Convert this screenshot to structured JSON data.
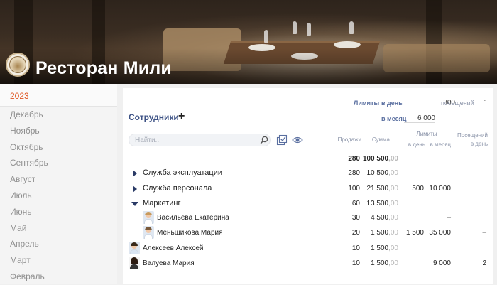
{
  "header": {
    "title": "Ресторан Мили"
  },
  "sidebar": {
    "items": [
      {
        "label": "2023"
      },
      {
        "label": "Декабрь"
      },
      {
        "label": "Ноябрь"
      },
      {
        "label": "Октябрь"
      },
      {
        "label": "Сентябрь"
      },
      {
        "label": "Август"
      },
      {
        "label": "Июль"
      },
      {
        "label": "Июнь"
      },
      {
        "label": "Май"
      },
      {
        "label": "Апрель"
      },
      {
        "label": "Март"
      },
      {
        "label": "Февраль"
      }
    ]
  },
  "limits": {
    "label": "Лимиты",
    "per_day_label": "в день",
    "per_month_label": "в месяц",
    "per_day_value": "300",
    "per_month_value": "6 000",
    "visits_label": "посещений",
    "visits_value": "1"
  },
  "employees": {
    "title": "Сотрудники",
    "search_placeholder": "Найти..."
  },
  "columns": {
    "sales": "Продажи",
    "sum": "Сумма",
    "limits": "Лимиты",
    "per_day": "в день",
    "per_month": "в месяц",
    "visits": "Посещений в день"
  },
  "totals": {
    "sales": "280",
    "sum_int": "100 500",
    "sum_dec": ",00"
  },
  "rows": [
    {
      "name": "Служба эксплуатации",
      "sales": "280",
      "sum_int": "10 500",
      "sum_dec": ",00",
      "day": "",
      "month": "",
      "visits": ""
    },
    {
      "name": "Служба персонала",
      "sales": "100",
      "sum_int": "21 500",
      "sum_dec": ",00",
      "day": "500",
      "month": "10 000",
      "visits": ""
    },
    {
      "name": "Маркетинг",
      "sales": "60",
      "sum_int": "13 500",
      "sum_dec": ",00",
      "day": "",
      "month": "",
      "visits": ""
    },
    {
      "name": "Васильева Екатерина",
      "sales": "30",
      "sum_int": "4 500",
      "sum_dec": ",00",
      "day": "",
      "month": "–",
      "visits": ""
    },
    {
      "name": "Меньшикова Мария",
      "sales": "20",
      "sum_int": "1 500",
      "sum_dec": ",00",
      "day": "1 500",
      "month": "35 000",
      "visits": "–"
    },
    {
      "name": "Алексеев Алексей",
      "sales": "10",
      "sum_int": "1 500",
      "sum_dec": ",00",
      "day": "",
      "month": "",
      "visits": ""
    },
    {
      "name": "Валуева Мария",
      "sales": "10",
      "sum_int": "1 500",
      "sum_dec": ",00",
      "day": "",
      "month": "9 000",
      "visits": "2"
    }
  ]
}
